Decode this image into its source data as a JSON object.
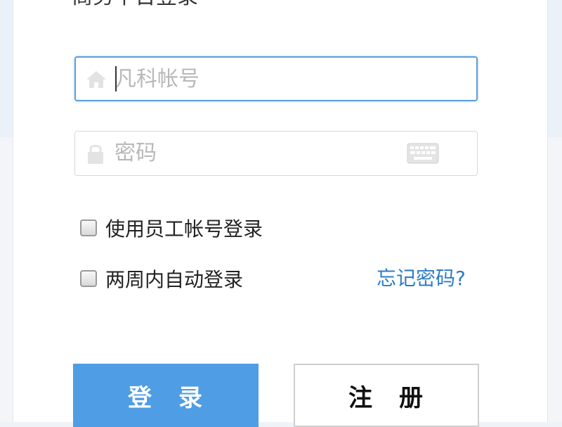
{
  "title": "商务平台登录",
  "username": {
    "placeholder": "凡科帐号",
    "value": "",
    "icon": "home-icon"
  },
  "password": {
    "placeholder": "密码",
    "value": "",
    "icon": "lock-icon",
    "keyboard_icon": "keyboard-icon"
  },
  "options": {
    "employee_login": "使用员工帐号登录",
    "auto_login": "两周内自动登录",
    "employee_checked": false,
    "auto_checked": false
  },
  "forgot_password": "忘记密码?",
  "buttons": {
    "login": "登　录",
    "register": "注　册"
  },
  "colors": {
    "primary": "#4f9de4",
    "focus_border": "#5b9fe0",
    "link": "#2d7cc6"
  }
}
